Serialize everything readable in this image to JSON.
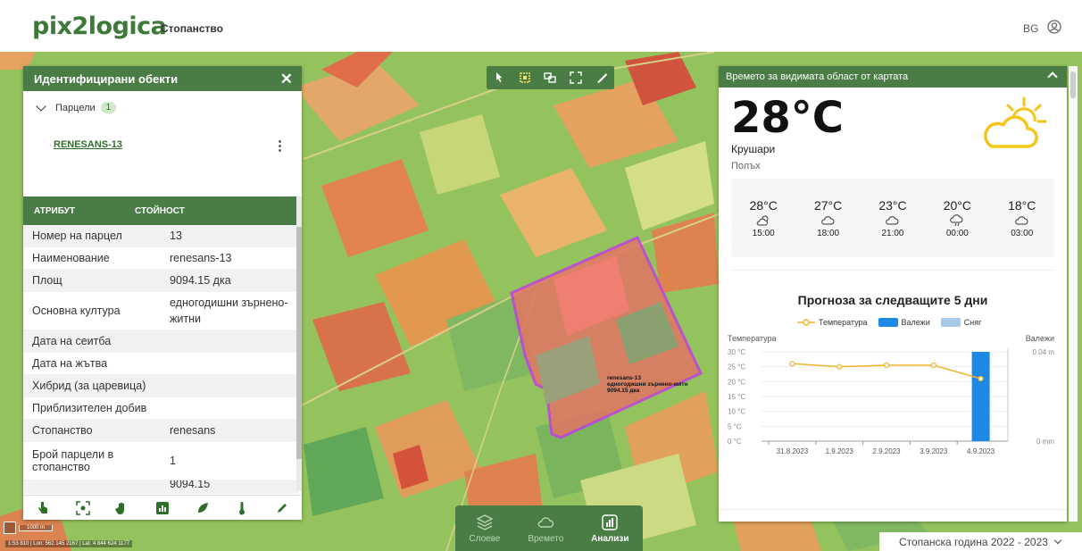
{
  "header": {
    "logo": "pix2logica",
    "farm_link": "Стопанство",
    "language": "BG"
  },
  "left_panel": {
    "title": "Идентифицирани обекти",
    "group_label": "Парцели",
    "group_count": "1",
    "parcel_name": "RENESANS-13",
    "col_attribute": "АТРИБУТ",
    "col_value": "СТОЙНОСТ",
    "rows": [
      {
        "k": "Номер на парцел",
        "v": "13"
      },
      {
        "k": "Наименование",
        "v": "renesans-13"
      },
      {
        "k": "Площ",
        "v": "9094.15 дка"
      },
      {
        "k": "Основна култура",
        "v": "едногодишни зърнено-житни"
      },
      {
        "k": "Дата на сеитба",
        "v": ""
      },
      {
        "k": "Дата на жътва",
        "v": ""
      },
      {
        "k": "Хибрид (за царевица)",
        "v": ""
      },
      {
        "k": "Приблизителен добив",
        "v": ""
      },
      {
        "k": "Стопанство",
        "v": "renesans"
      },
      {
        "k": "Брой парцели в стопанство",
        "v": "1"
      }
    ],
    "partial_row_value": "9094.15"
  },
  "map": {
    "parcel_label_line1": "renesans-13",
    "parcel_label_line2": "едногодишни зърнено-житн",
    "parcel_label_line3": "9094.15 дка",
    "scale": "1000 m",
    "coords": "1:53 810  |  Lon: 562 145 2167  |  Lat: 4 844 624 1177"
  },
  "weather": {
    "title": "Времето за видимата област от картата",
    "temperature": "28°C",
    "town": "Крушари",
    "region": "Полъх",
    "hourly": [
      {
        "temp": "28°C",
        "time": "15:00",
        "icon": "sun-cloud-icon"
      },
      {
        "temp": "27°C",
        "time": "18:00",
        "icon": "cloud-icon"
      },
      {
        "temp": "23°C",
        "time": "21:00",
        "icon": "cloud-icon"
      },
      {
        "temp": "20°C",
        "time": "00:00",
        "icon": "cloud-rain-icon"
      },
      {
        "temp": "18°C",
        "time": "03:00",
        "icon": "cloud-icon"
      }
    ],
    "forecast_title": "Прогноза за следващите 5 дни",
    "legend_temp": "Температура",
    "legend_rain": "Валежи",
    "legend_snow": "Сняг"
  },
  "chart_data": {
    "type": "line",
    "title": "Прогноза за следващите 5 дни",
    "ylabel_left": "Температура",
    "ylabel_right": "Валежи",
    "x": [
      "31.8.2023",
      "1.9.2023",
      "2.9.2023",
      "3.9.2023",
      "4.9.2023"
    ],
    "y_ticks": [
      "30 °C",
      "25 °C",
      "20 °C",
      "15 °C",
      "10 °C",
      "5 °C",
      "0 °C"
    ],
    "right_ticks": [
      "0.04 m",
      "0 mm"
    ],
    "ylim": [
      0,
      30
    ],
    "series": [
      {
        "name": "Температура",
        "values": [
          26,
          25,
          25.5,
          25.5,
          21
        ],
        "color": "#f0b429"
      },
      {
        "name": "Валежи",
        "values": [
          0,
          0,
          0,
          0,
          0.04
        ],
        "color": "#1e88e5"
      },
      {
        "name": "Сняг",
        "values": [
          0,
          0,
          0,
          0,
          0
        ],
        "color": "#a9c9e8"
      }
    ]
  },
  "bottom_nav": {
    "items": [
      {
        "label": "Слоеве"
      },
      {
        "label": "Времето"
      },
      {
        "label": "Анализи"
      }
    ]
  },
  "season": "Стопанска година 2022 - 2023",
  "colors": {
    "brand_green": "#4a7c46",
    "parcel_outline": "#c040e0",
    "temp_line": "#f0b429",
    "rain_bar": "#1e88e5"
  }
}
